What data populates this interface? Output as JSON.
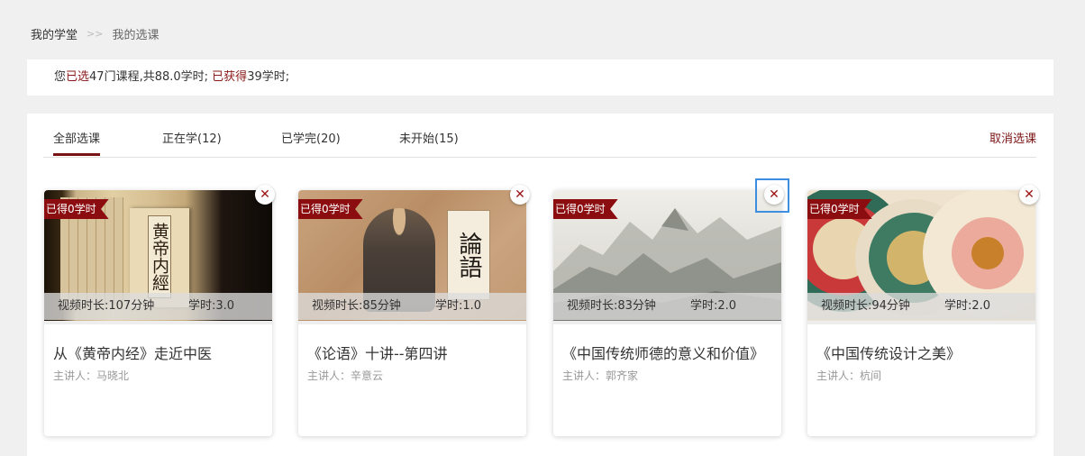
{
  "breadcrumb": {
    "home": "我的学堂",
    "separator": ">>",
    "current": "我的选课"
  },
  "summary": {
    "prefix": "您",
    "selected_label": "已选",
    "selected_count": "47门课程,共88.0学时;",
    "earned_label": "已获得",
    "earned_value": "39学时;"
  },
  "tabs": [
    {
      "label": "全部选课",
      "active": true
    },
    {
      "label": "正在学(12)"
    },
    {
      "label": "已学完(20)"
    },
    {
      "label": "未开始(15)"
    }
  ],
  "cancel_label": "取消选课",
  "close_symbol": "✕",
  "courses": [
    {
      "earned": "已得0学时",
      "duration": "视频时长:107分钟",
      "hours": "学时:3.0",
      "title": "从《黄帝内经》走近中医",
      "lecturer": "主讲人：马晓北",
      "book_text": "黄帝内經"
    },
    {
      "earned": "已得0学时",
      "duration": "视频时长:85分钟",
      "hours": "学时:1.0",
      "title": "《论语》十讲--第四讲",
      "lecturer": "主讲人：辛意云",
      "book_text": "論語"
    },
    {
      "earned": "已得0学时",
      "duration": "视频时长:83分钟",
      "hours": "学时:2.0",
      "title": "《中国传统师德的意义和价值》",
      "lecturer": "主讲人：郭齐家"
    },
    {
      "earned": "已得0学时",
      "duration": "视频时长:94分钟",
      "hours": "学时:2.0",
      "title": "《中国传统设计之美》",
      "lecturer": "主讲人：杭间"
    }
  ]
}
